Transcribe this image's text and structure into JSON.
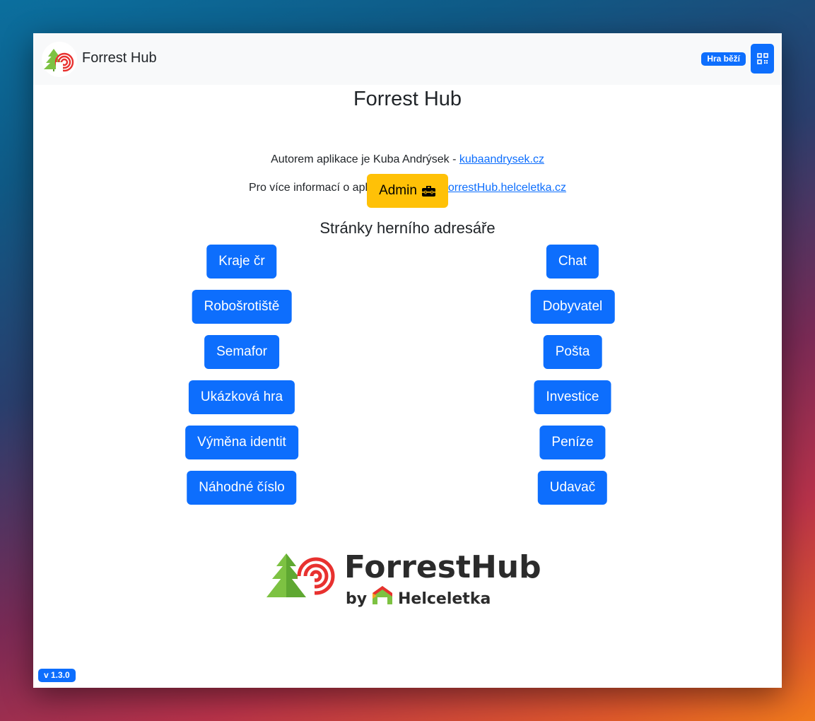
{
  "header": {
    "app_title": "Forrest Hub",
    "status_badge": "Hra běží",
    "qr_icon": "qr-code-icon",
    "logo_icon": "forresthub-logo"
  },
  "main": {
    "title": "Forrest Hub",
    "author_text": "Autorem aplikace je Kuba Andrýsek - ",
    "author_link": "kubaandrysek.cz",
    "info_text": "Pro více informací o aplikaci navštivte ",
    "info_link": "ForrestHub.helceletka.cz",
    "admin_label": "Admin",
    "admin_icon": "toolbox-icon",
    "section_title": "Stránky herního adresáře"
  },
  "pages_left": [
    "Kraje čr",
    "Robošrotiště",
    "Semafor",
    "Ukázková hra",
    "Výměna identit",
    "Náhodné číslo"
  ],
  "pages_right": [
    "Chat",
    "Dobyvatel",
    "Pošta",
    "Investice",
    "Peníze",
    "Udavač"
  ],
  "footer": {
    "brand_name": "ForrestHub",
    "by_text": "by",
    "partner_name": "Helceletka",
    "version": "v 1.3.0"
  },
  "colors": {
    "primary": "#0d6efd",
    "admin": "#ffc107",
    "tree_green": "#7dc242",
    "radar_red": "#e8312f"
  }
}
